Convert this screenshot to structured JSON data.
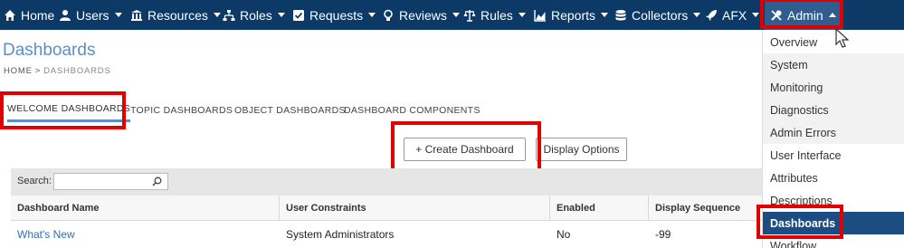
{
  "nav": {
    "items": [
      {
        "label": "Home",
        "icon": "home-icon"
      },
      {
        "label": "Users",
        "icon": "users-icon"
      },
      {
        "label": "Resources",
        "icon": "bank-icon"
      },
      {
        "label": "Roles",
        "icon": "sitemap-icon"
      },
      {
        "label": "Requests",
        "icon": "checkbox-icon"
      },
      {
        "label": "Reviews",
        "icon": "lightbulb-icon"
      },
      {
        "label": "Rules",
        "icon": "balance-icon"
      },
      {
        "label": "Reports",
        "icon": "chart-icon"
      },
      {
        "label": "Collectors",
        "icon": "database-icon"
      },
      {
        "label": "AFX",
        "icon": "rocket-icon"
      },
      {
        "label": "Admin",
        "icon": "tools-icon"
      }
    ]
  },
  "page": {
    "title": "Dashboards",
    "breadcrumb": {
      "home": "HOME",
      "separator": ">",
      "current": "DASHBOARDS"
    }
  },
  "tabs": [
    {
      "label": "WELCOME DASHBOARDS",
      "active": true
    },
    {
      "label": "TOPIC DASHBOARDS",
      "active": false
    },
    {
      "label": "OBJECT DASHBOARDS",
      "active": false
    },
    {
      "label": "DASHBOARD COMPONENTS",
      "active": false
    }
  ],
  "toolbar": {
    "create_label": "+  Create Dashboard",
    "display_options_label": "Display Options"
  },
  "grid": {
    "search_label": "Search:",
    "search_value": "",
    "columns": [
      "Dashboard Name",
      "User Constraints",
      "Enabled",
      "Display Sequence"
    ],
    "rows": [
      [
        "What's New",
        "System Administrators",
        "No",
        "-99"
      ]
    ]
  },
  "admin_menu": {
    "items": [
      "Overview",
      "System",
      "Monitoring",
      "Diagnostics",
      "Admin Errors",
      "User Interface",
      "Attributes",
      "Descriptions",
      "Dashboards",
      "Workflow"
    ],
    "selected": "Dashboards"
  },
  "colors": {
    "nav_bg": "#0d3966",
    "accent": "#5b8fc7",
    "selected_bg": "#1b4c82",
    "highlight_box": "#e00000"
  }
}
